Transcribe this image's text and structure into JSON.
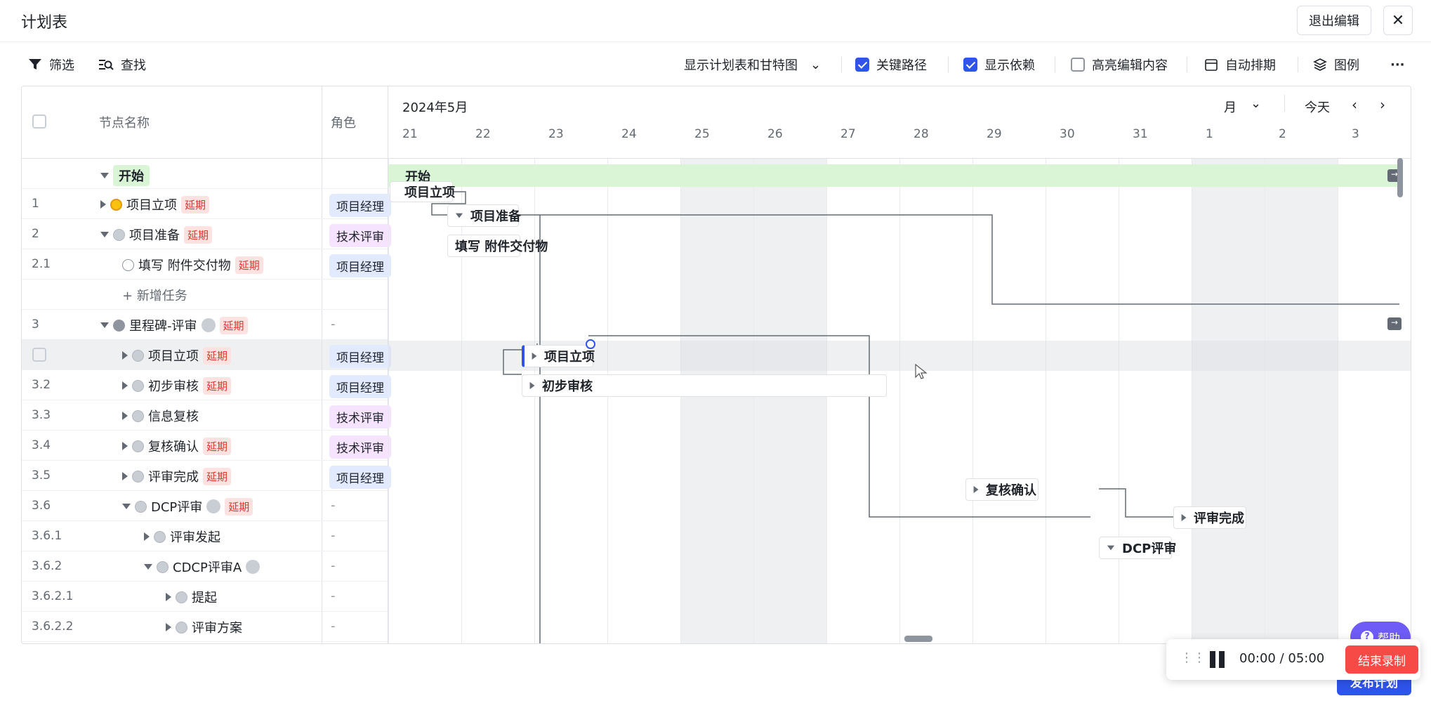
{
  "header": {
    "title": "计划表",
    "exit_label": "退出编辑",
    "close_icon": "✕"
  },
  "toolbar": {
    "filter": "筛选",
    "find": "查找",
    "view_select": "显示计划表和甘特图",
    "critical_path": "关键路径",
    "show_deps": "显示依赖",
    "highlight": "高亮编辑内容",
    "auto_schedule": "自动排期",
    "legend": "图例",
    "more": "···",
    "critical_path_checked": true,
    "show_deps_checked": true,
    "highlight_checked": false
  },
  "table": {
    "col_name": "节点名称",
    "col_role": "角色",
    "rows": [
      {
        "num": "",
        "name": "开始",
        "role": ""
      },
      {
        "num": "1",
        "name": "项目立项",
        "tag": "延期",
        "role": "项目经理"
      },
      {
        "num": "2",
        "name": "项目准备",
        "tag": "延期",
        "role": "技术评审"
      },
      {
        "num": "2.1",
        "name": "填写 附件交付物",
        "tag": "延期",
        "role": "项目经理"
      },
      {
        "num": "",
        "name": "+ 新增任务",
        "role": ""
      },
      {
        "num": "3",
        "name": "里程碑-评审",
        "tag": "延期",
        "role": "-"
      },
      {
        "num": "",
        "name": "项目立项",
        "tag": "延期",
        "role": "项目经理"
      },
      {
        "num": "3.2",
        "name": "初步审核",
        "tag": "延期",
        "role": "项目经理"
      },
      {
        "num": "3.3",
        "name": "信息复核",
        "role": "技术评审"
      },
      {
        "num": "3.4",
        "name": "复核确认",
        "tag": "延期",
        "role": "技术评审"
      },
      {
        "num": "3.5",
        "name": "评审完成",
        "tag": "延期",
        "role": "项目经理"
      },
      {
        "num": "3.6",
        "name": "DCP评审",
        "tag": "延期",
        "role": "-"
      },
      {
        "num": "3.6.1",
        "name": "评审发起",
        "role": "-"
      },
      {
        "num": "3.6.2",
        "name": "CDCP评审A",
        "role": "-"
      },
      {
        "num": "3.6.2.1",
        "name": "提起",
        "role": "-"
      },
      {
        "num": "3.6.2.2",
        "name": "评审方案",
        "role": "-"
      }
    ]
  },
  "gantt": {
    "month": "2024年5月",
    "scale": "月",
    "today": "今天",
    "days": [
      "21",
      "22",
      "23",
      "24",
      "25",
      "26",
      "27",
      "28",
      "29",
      "30",
      "31",
      "1",
      "2",
      "3"
    ],
    "bars": {
      "start": "开始",
      "b1": "项目立项",
      "b2": "项目准备",
      "b21": "填写 附件交付物",
      "b31": "项目立项",
      "b32": "初步审核",
      "b34": "复核确认",
      "b35": "评审完成",
      "b36": "DCP评审"
    }
  },
  "recorder": {
    "time": "00:00 / 05:00",
    "stop": "结束录制"
  },
  "help": "帮助",
  "publish": "发布计划"
}
